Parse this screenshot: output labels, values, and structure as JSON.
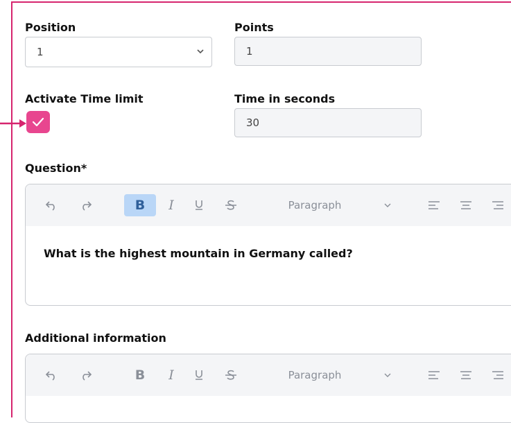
{
  "position": {
    "label": "Position",
    "value": "1"
  },
  "points": {
    "label": "Points",
    "value": "1"
  },
  "time_limit": {
    "label": "Activate Time limit",
    "checked": true
  },
  "time_seconds": {
    "label": "Time in seconds",
    "value": "30"
  },
  "question": {
    "label": "Question*",
    "content": "What is the highest mountain in Germany called?",
    "toolbar": {
      "bold": "B",
      "italic": "I",
      "paragraph": "Paragraph",
      "bold_active": true
    }
  },
  "additional": {
    "label": "Additional information",
    "toolbar": {
      "bold": "B",
      "italic": "I",
      "paragraph": "Paragraph"
    }
  },
  "colors": {
    "accent": "#e8468f",
    "frame": "#d6246e",
    "bold_active_bg": "#b9d6f7"
  }
}
